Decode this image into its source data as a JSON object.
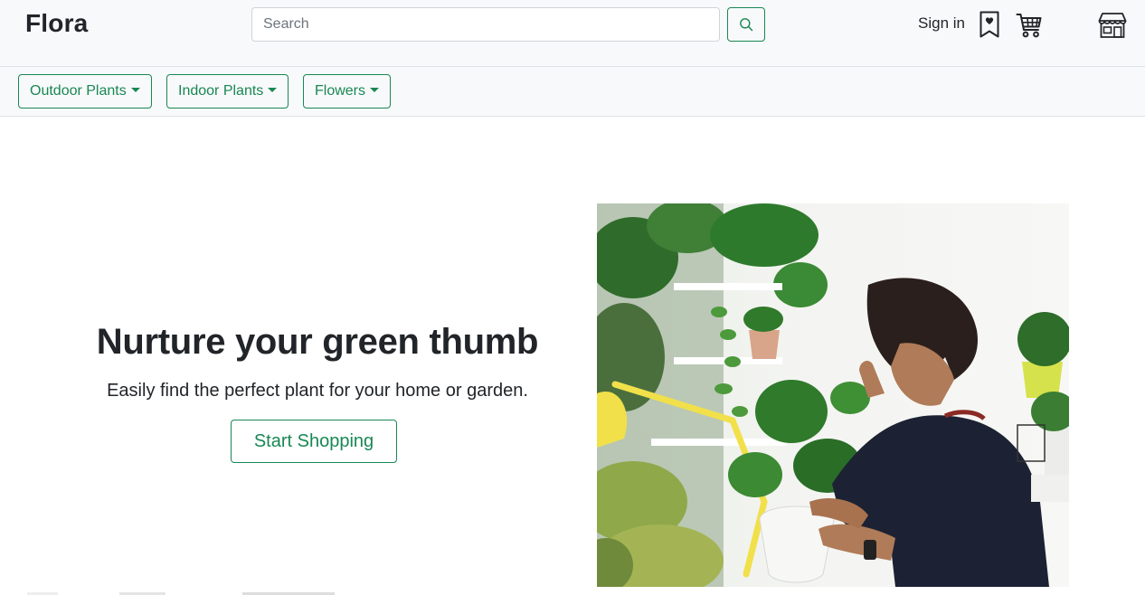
{
  "header": {
    "brand": "Flora",
    "search": {
      "placeholder": "Search",
      "value": ""
    },
    "signin_label": "Sign in",
    "icons": [
      "search-icon",
      "bookmark-heart-icon",
      "cart-icon",
      "shop-icon"
    ]
  },
  "categories": [
    {
      "label": "Outdoor Plants"
    },
    {
      "label": "Indoor Plants"
    },
    {
      "label": "Flowers"
    }
  ],
  "hero": {
    "title": "Nurture your green thumb",
    "subtitle": "Easily find the perfect plant for your home or garden.",
    "cta_label": "Start Shopping"
  },
  "colors": {
    "accent": "#198754",
    "navbar_bg": "#f8f9fa",
    "text": "#212529"
  }
}
